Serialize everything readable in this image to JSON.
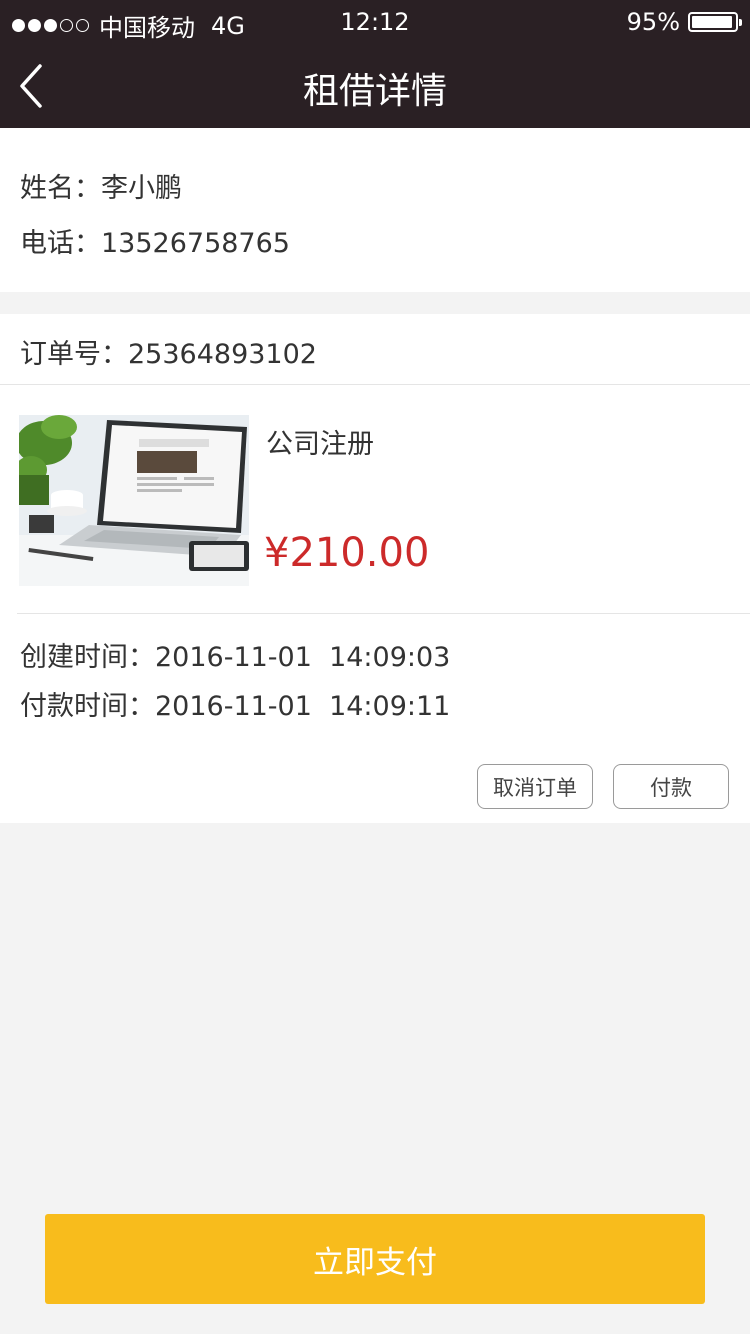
{
  "status_bar": {
    "carrier": "中国移动",
    "network": "4G",
    "time": "12:12",
    "battery": "95%",
    "battery_level": 0.95,
    "signal_bars_filled": 3,
    "signal_bars_total": 5
  },
  "nav": {
    "title": "租借详情",
    "back_icon": "chevron-left-icon"
  },
  "user": {
    "name_label": "姓名：",
    "name_value": "李小鹏",
    "phone_label": "电话：",
    "phone_value": "13526758765"
  },
  "order": {
    "number_label": "订单号：",
    "number_value": "25364893102",
    "product_name": "公司注册",
    "price": "¥210.00",
    "created_label": "创建时间：",
    "created_value": "2016-11-01  14:09:03",
    "paid_label": "付款时间：",
    "paid_value": "2016-11-01  14:09:11",
    "cancel_button": "取消订单",
    "pay_button": "付款"
  },
  "footer": {
    "pay_now_button": "立即支付"
  },
  "colors": {
    "header_bg": "#2a2024",
    "price": "#cc2a2a",
    "accent": "#f8bc1c"
  }
}
